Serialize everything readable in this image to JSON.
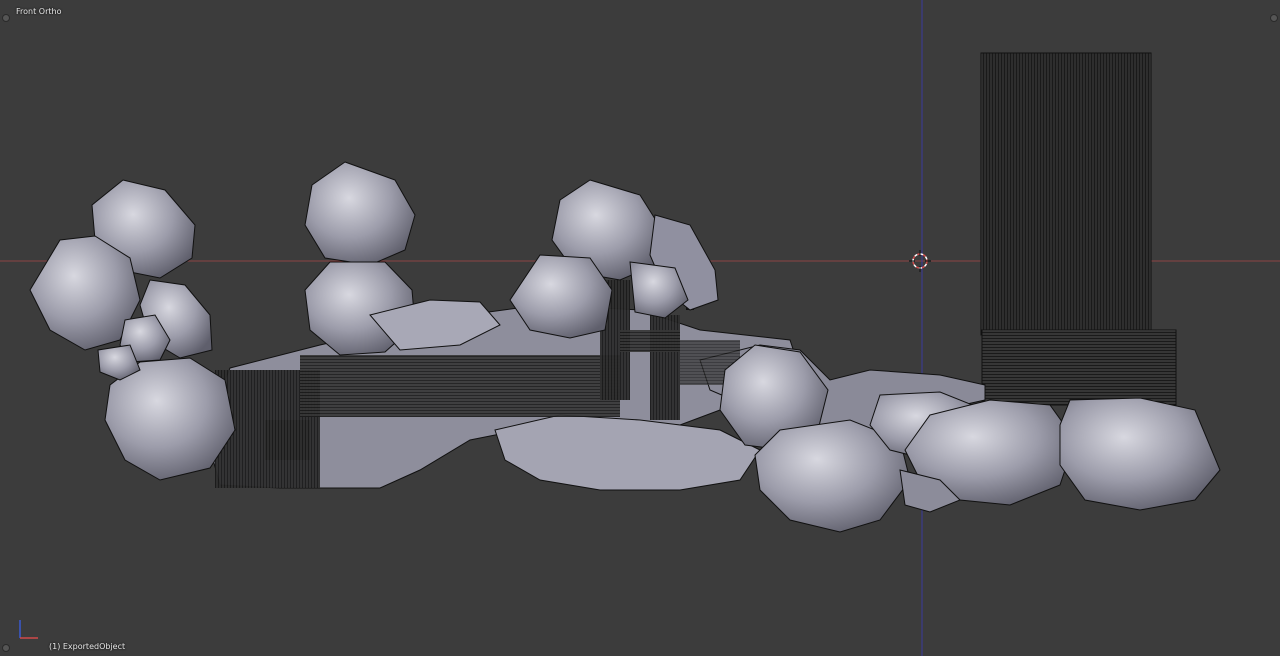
{
  "viewport": {
    "view_label": "Front Ortho",
    "object_label": "(1) ExportedObject"
  },
  "colors": {
    "background": "#3c3c3c",
    "x_axis": "#b44a4a",
    "z_axis": "#3a3aa8",
    "mesh_fill": "#9a9aa6",
    "mesh_light": "#c8c8d2",
    "wire": "#111111"
  },
  "icons": [
    "cursor-3d-icon",
    "axis-gizmo-icon",
    "viewport-corner-handle-icon"
  ]
}
